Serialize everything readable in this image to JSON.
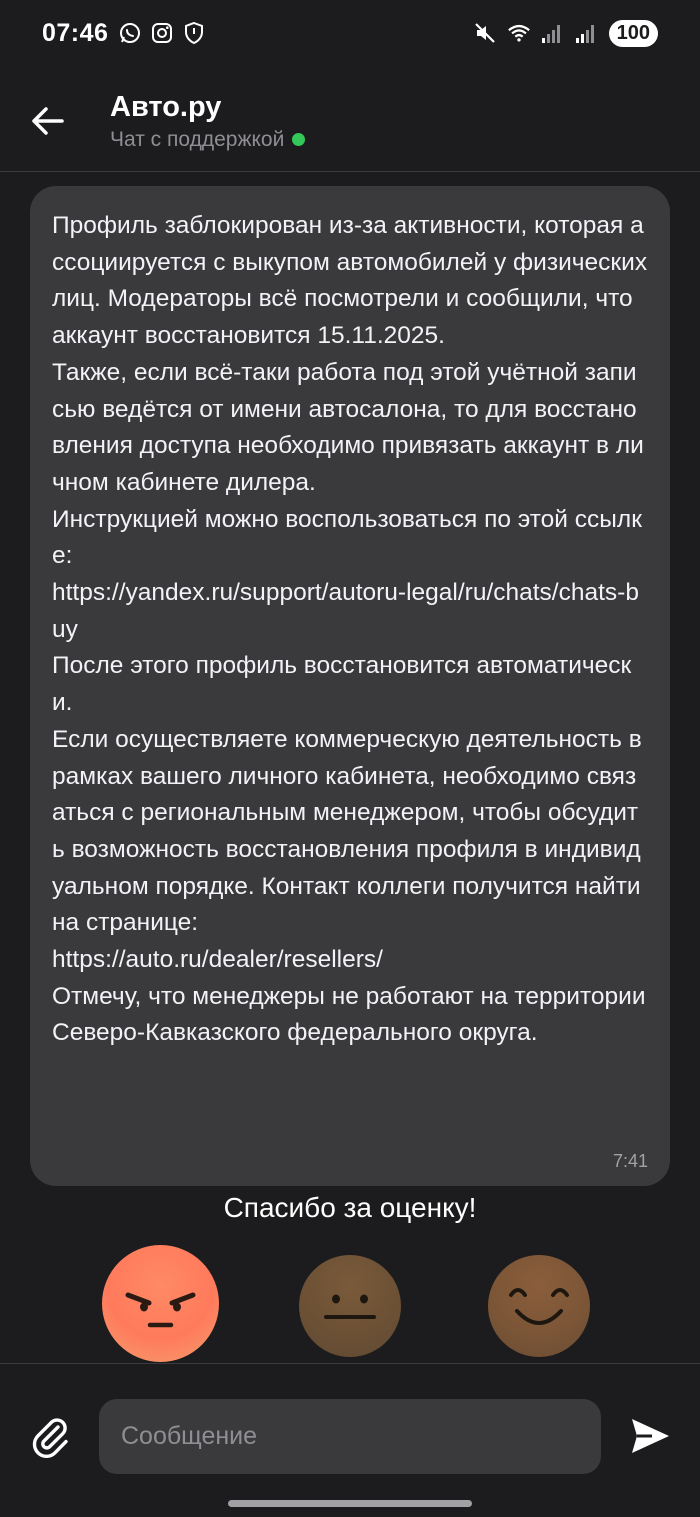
{
  "status_bar": {
    "time": "07:46",
    "left_icons": [
      "whatsapp-icon",
      "instagram-icon",
      "shield-icon"
    ],
    "right_icons": [
      "mute-icon",
      "wifi-icon",
      "signal-1-icon",
      "signal-2-icon"
    ],
    "battery": "100"
  },
  "header": {
    "title": "Авто.ру",
    "subtitle": "Чат с поддержкой",
    "online_color": "#34c759"
  },
  "message": {
    "text": "Профиль заблокирован из-за активности, которая ассоциируется с выкупом автомобилей у физических лиц. Модераторы всё посмотрели и сообщили, что аккаунт восстановится 15.11.2025.\nТакже, если всё-таки работа под этой учётной записью ведётся от имени автосалона, то для восстановления доступа необходимо привязать аккаунт в личном кабинете дилера.\nИнструкцией можно воспользоваться по этой ссылке:\nhttps://yandex.ru/support/autoru-legal/ru/chats/chats-buy\nПосле этого профиль восстановится автоматически.\nЕсли осуществляете коммерческую деятельность в рамках вашего личного кабинета, необходимо связаться с региональным менеджером, чтобы обсудить возможность восстановления профиля в индивидуальном порядке. Контакт коллеги получится найти на странице:\nhttps://auto.ru/dealer/resellers/\nОтмечу, что менеджеры не работают на территории Северо-Кавказского федерального округа.",
    "time": "7:41"
  },
  "rating": {
    "title": "Спасибо за оценку!",
    "options": [
      "angry-emoji",
      "neutral-emoji",
      "happy-emoji"
    ],
    "selected": "angry-emoji"
  },
  "composer": {
    "placeholder": "Сообщение"
  },
  "colors": {
    "background": "#1c1c1e",
    "bubble": "#3a3a3c",
    "accent_online": "#34c759"
  }
}
